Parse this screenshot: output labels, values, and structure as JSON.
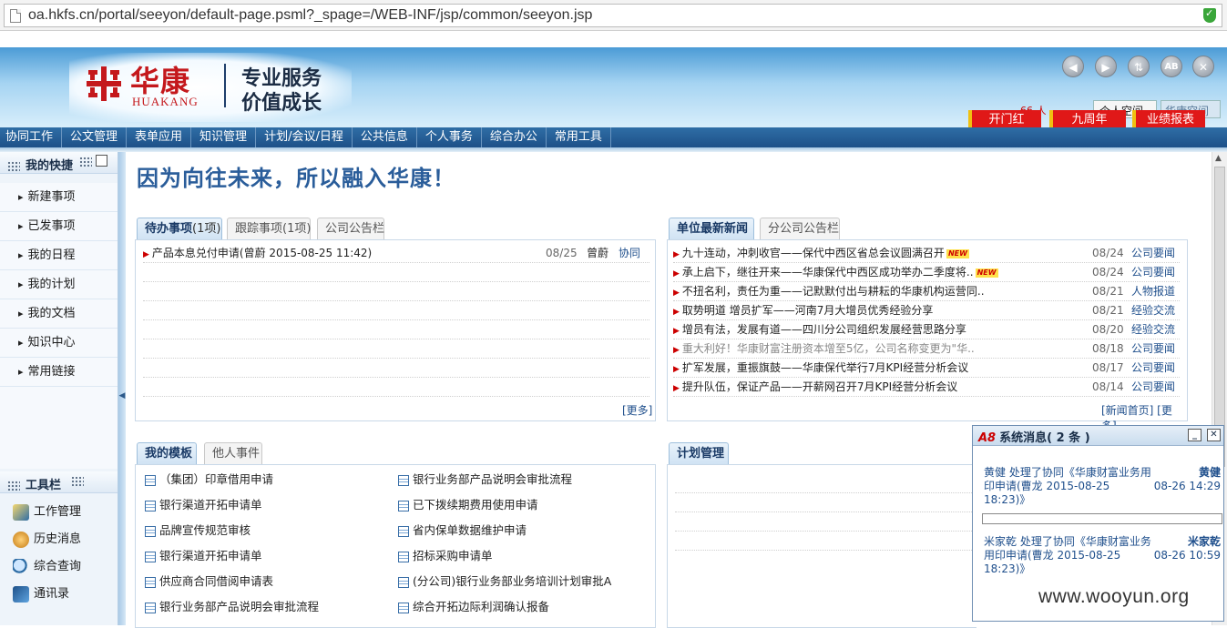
{
  "browser": {
    "url": "oa.hkfs.cn/portal/seeyon/default-page.psml?_spage=/WEB-INF/jsp/common/seeyon.jsp"
  },
  "header": {
    "logo_cn": "华康",
    "logo_en": "HUAKANG",
    "slogan_line1": "专业服务",
    "slogan_line2": "价值成长",
    "buttons": [
      "back",
      "forward",
      "refresh",
      "ab",
      "close"
    ],
    "notice_count": "66 人",
    "personal_space": "个人空间",
    "company_space": "华康空间",
    "red_tabs": [
      "开门红",
      "九周年",
      "业绩报表"
    ]
  },
  "nav": {
    "items": [
      "协同工作",
      "公文管理",
      "表单应用",
      "知识管理",
      "计划/会议/日程",
      "公共信息",
      "个人事务",
      "综合办公",
      "常用工具"
    ]
  },
  "sidebar": {
    "shortcut_title": "我的快捷",
    "shortcut_items": [
      "新建事项",
      "已发事项",
      "我的日程",
      "我的计划",
      "我的文档",
      "知识中心",
      "常用链接"
    ],
    "toolbar_title": "工具栏",
    "tool_items": [
      "工作管理",
      "历史消息",
      "综合查询",
      "通讯录"
    ]
  },
  "main": {
    "motto": "因为向往未来，所以融入华康！",
    "todo_tabs": {
      "active": "待办事项",
      "active_count": "(1项)",
      "t2": "跟踪事项(1项)",
      "t3": "公司公告栏"
    },
    "todo_rows": [
      {
        "title": "产品本息兑付申请(曾蔚 2015-08-25 11:42)",
        "date": "08/25",
        "sender": "曾蔚",
        "type": "协同"
      }
    ],
    "todo_more": "[更多]",
    "news_tabs": {
      "active": "单位最新新闻",
      "t2": "分公司公告栏"
    },
    "news_rows": [
      {
        "title": "九十连动，冲刺收官——保代中西区省总会议圆满召开",
        "new": true,
        "date": "08/24",
        "cat": "公司要闻"
      },
      {
        "title": "承上启下，继往开来——华康保代中西区成功举办二季度将..",
        "new": true,
        "date": "08/24",
        "cat": "公司要闻"
      },
      {
        "title": "不扭名利，责任为重——记默默付出与耕耘的华康机构运营同..",
        "new": false,
        "date": "08/21",
        "cat": "人物报道"
      },
      {
        "title": "取势明道 增员扩军——河南7月大增员优秀经验分享",
        "new": false,
        "date": "08/21",
        "cat": "经验交流"
      },
      {
        "title": "增员有法，发展有道——四川分公司组织发展经营思路分享",
        "new": false,
        "date": "08/20",
        "cat": "经验交流"
      },
      {
        "title": "重大利好！华康财富注册资本增至5亿，公司名称变更为\"华..",
        "new": false,
        "date": "08/18",
        "cat": "公司要闻",
        "gray": true
      },
      {
        "title": "扩军发展，重振旗鼓——华康保代举行7月KPI经营分析会议",
        "new": false,
        "date": "08/17",
        "cat": "公司要闻"
      },
      {
        "title": "提升队伍，保证产品——开薪网召开7月KPI经营分析会议",
        "new": false,
        "date": "08/14",
        "cat": "公司要闻"
      }
    ],
    "news_links": "[新闻首页] [更多]",
    "new_badge": "NEW",
    "tpl_tabs": {
      "active": "我的模板",
      "t2": "他人事件"
    },
    "templates_left": [
      "（集团）印章借用申请",
      "银行渠道开拓申请单",
      "品牌宣传规范审核",
      "银行渠道开拓申请单",
      "供应商合同借阅申请表",
      "银行业务部产品说明会审批流程"
    ],
    "templates_right": [
      "银行业务部产品说明会审批流程",
      "已下拨续期费用使用申请",
      "省内保单数据维护申请",
      "招标采购申请单",
      "(分公司)银行业务部业务培训计划审批A",
      "综合开拓边际利润确认报备"
    ],
    "plan_tab": "计划管理"
  },
  "popup": {
    "title": "系统消息",
    "count": "( 2 条 )",
    "messages": [
      {
        "text": "黄健 处理了协同《华康财富业务用印申请(曹龙 2015-08-25 18:23)》",
        "who": "黄健",
        "when": "08-26 14:29"
      },
      {
        "text": "米家乾 处理了协同《华康财富业务用印申请(曹龙 2015-08-25 18:23)》",
        "who": "米家乾",
        "when": "08-26 10:59"
      }
    ]
  },
  "watermark": "www.wooyun.org",
  "colors": {
    "nav_bg": "#1d5088",
    "brand_red": "#c4181c",
    "link_blue": "#1f4f8c",
    "red_tab": "#e01818"
  }
}
